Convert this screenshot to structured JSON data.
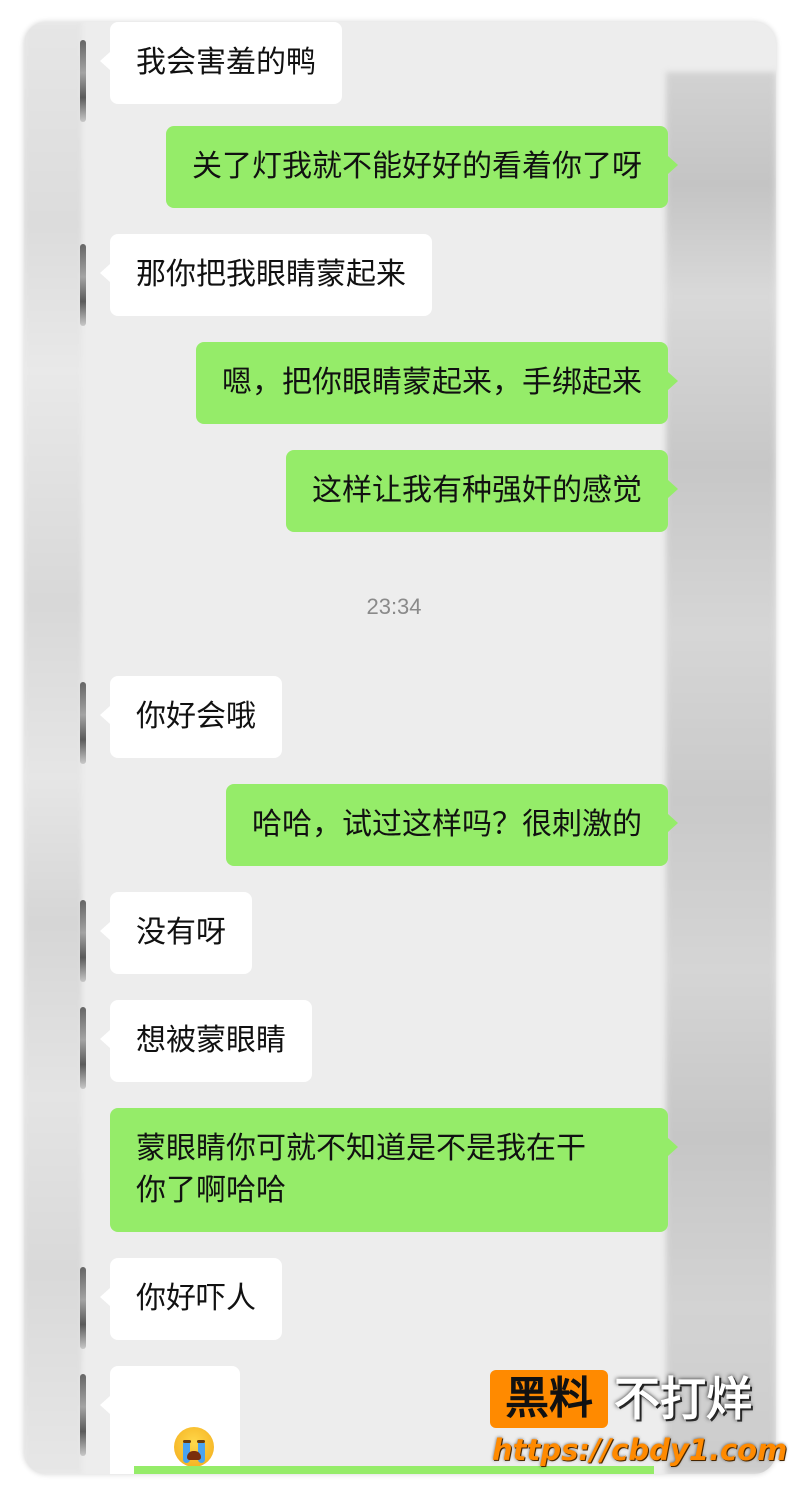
{
  "chat": {
    "messages": [
      {
        "sender": "them",
        "text": "我会害羞的鸭"
      },
      {
        "sender": "me",
        "text": "关了灯我就不能好好的看着你了呀"
      },
      {
        "sender": "them",
        "text": "那你把我眼睛蒙起来"
      },
      {
        "sender": "me",
        "text": "嗯，把你眼睛蒙起来，手绑起来"
      },
      {
        "sender": "me",
        "text": "这样让我有种强奸的感觉"
      },
      {
        "sender": "them",
        "text": "你好会哦"
      },
      {
        "sender": "me",
        "text": "哈哈，试过这样吗？很刺激的"
      },
      {
        "sender": "them",
        "text": "没有呀"
      },
      {
        "sender": "them",
        "text": "想被蒙眼睛"
      },
      {
        "sender": "me",
        "text": "蒙眼睛你可就不知道是不是我在干\n你了啊哈哈"
      },
      {
        "sender": "them",
        "text": "你好吓人"
      },
      {
        "sender": "them",
        "emoji": "crying-face-icon"
      }
    ],
    "timestamp": "23:34"
  },
  "colors": {
    "chat_background": "#ededed",
    "my_bubble": "#95ec69",
    "their_bubble": "#ffffff",
    "watermark_accent": "#ff8a00"
  },
  "watermark": {
    "badge": "黑料",
    "text": "不打烊",
    "url": "https://cbdy1.com"
  }
}
